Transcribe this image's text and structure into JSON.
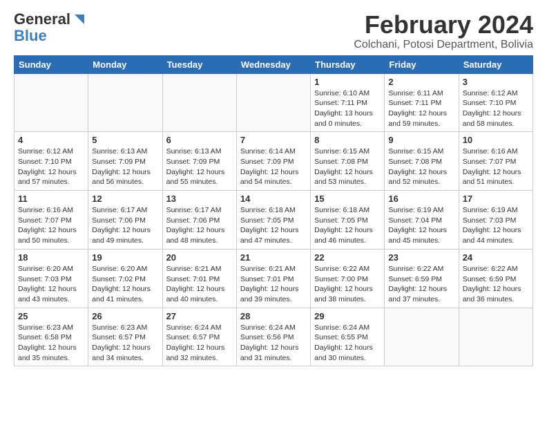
{
  "logo": {
    "general": "General",
    "blue": "Blue"
  },
  "title": "February 2024",
  "subtitle": "Colchani, Potosi Department, Bolivia",
  "days_of_week": [
    "Sunday",
    "Monday",
    "Tuesday",
    "Wednesday",
    "Thursday",
    "Friday",
    "Saturday"
  ],
  "weeks": [
    [
      {
        "day": "",
        "empty": true
      },
      {
        "day": "",
        "empty": true
      },
      {
        "day": "",
        "empty": true
      },
      {
        "day": "",
        "empty": true
      },
      {
        "day": "1",
        "sunrise": "6:10 AM",
        "sunset": "7:11 PM",
        "daylight": "13 hours and 0 minutes."
      },
      {
        "day": "2",
        "sunrise": "6:11 AM",
        "sunset": "7:11 PM",
        "daylight": "12 hours and 59 minutes."
      },
      {
        "day": "3",
        "sunrise": "6:12 AM",
        "sunset": "7:10 PM",
        "daylight": "12 hours and 58 minutes."
      }
    ],
    [
      {
        "day": "4",
        "sunrise": "6:12 AM",
        "sunset": "7:10 PM",
        "daylight": "12 hours and 57 minutes."
      },
      {
        "day": "5",
        "sunrise": "6:13 AM",
        "sunset": "7:09 PM",
        "daylight": "12 hours and 56 minutes."
      },
      {
        "day": "6",
        "sunrise": "6:13 AM",
        "sunset": "7:09 PM",
        "daylight": "12 hours and 55 minutes."
      },
      {
        "day": "7",
        "sunrise": "6:14 AM",
        "sunset": "7:09 PM",
        "daylight": "12 hours and 54 minutes."
      },
      {
        "day": "8",
        "sunrise": "6:15 AM",
        "sunset": "7:08 PM",
        "daylight": "12 hours and 53 minutes."
      },
      {
        "day": "9",
        "sunrise": "6:15 AM",
        "sunset": "7:08 PM",
        "daylight": "12 hours and 52 minutes."
      },
      {
        "day": "10",
        "sunrise": "6:16 AM",
        "sunset": "7:07 PM",
        "daylight": "12 hours and 51 minutes."
      }
    ],
    [
      {
        "day": "11",
        "sunrise": "6:16 AM",
        "sunset": "7:07 PM",
        "daylight": "12 hours and 50 minutes."
      },
      {
        "day": "12",
        "sunrise": "6:17 AM",
        "sunset": "7:06 PM",
        "daylight": "12 hours and 49 minutes."
      },
      {
        "day": "13",
        "sunrise": "6:17 AM",
        "sunset": "7:06 PM",
        "daylight": "12 hours and 48 minutes."
      },
      {
        "day": "14",
        "sunrise": "6:18 AM",
        "sunset": "7:05 PM",
        "daylight": "12 hours and 47 minutes."
      },
      {
        "day": "15",
        "sunrise": "6:18 AM",
        "sunset": "7:05 PM",
        "daylight": "12 hours and 46 minutes."
      },
      {
        "day": "16",
        "sunrise": "6:19 AM",
        "sunset": "7:04 PM",
        "daylight": "12 hours and 45 minutes."
      },
      {
        "day": "17",
        "sunrise": "6:19 AM",
        "sunset": "7:03 PM",
        "daylight": "12 hours and 44 minutes."
      }
    ],
    [
      {
        "day": "18",
        "sunrise": "6:20 AM",
        "sunset": "7:03 PM",
        "daylight": "12 hours and 43 minutes."
      },
      {
        "day": "19",
        "sunrise": "6:20 AM",
        "sunset": "7:02 PM",
        "daylight": "12 hours and 41 minutes."
      },
      {
        "day": "20",
        "sunrise": "6:21 AM",
        "sunset": "7:01 PM",
        "daylight": "12 hours and 40 minutes."
      },
      {
        "day": "21",
        "sunrise": "6:21 AM",
        "sunset": "7:01 PM",
        "daylight": "12 hours and 39 minutes."
      },
      {
        "day": "22",
        "sunrise": "6:22 AM",
        "sunset": "7:00 PM",
        "daylight": "12 hours and 38 minutes."
      },
      {
        "day": "23",
        "sunrise": "6:22 AM",
        "sunset": "6:59 PM",
        "daylight": "12 hours and 37 minutes."
      },
      {
        "day": "24",
        "sunrise": "6:22 AM",
        "sunset": "6:59 PM",
        "daylight": "12 hours and 36 minutes."
      }
    ],
    [
      {
        "day": "25",
        "sunrise": "6:23 AM",
        "sunset": "6:58 PM",
        "daylight": "12 hours and 35 minutes."
      },
      {
        "day": "26",
        "sunrise": "6:23 AM",
        "sunset": "6:57 PM",
        "daylight": "12 hours and 34 minutes."
      },
      {
        "day": "27",
        "sunrise": "6:24 AM",
        "sunset": "6:57 PM",
        "daylight": "12 hours and 32 minutes."
      },
      {
        "day": "28",
        "sunrise": "6:24 AM",
        "sunset": "6:56 PM",
        "daylight": "12 hours and 31 minutes."
      },
      {
        "day": "29",
        "sunrise": "6:24 AM",
        "sunset": "6:55 PM",
        "daylight": "12 hours and 30 minutes."
      },
      {
        "day": "",
        "empty": true
      },
      {
        "day": "",
        "empty": true
      }
    ]
  ]
}
